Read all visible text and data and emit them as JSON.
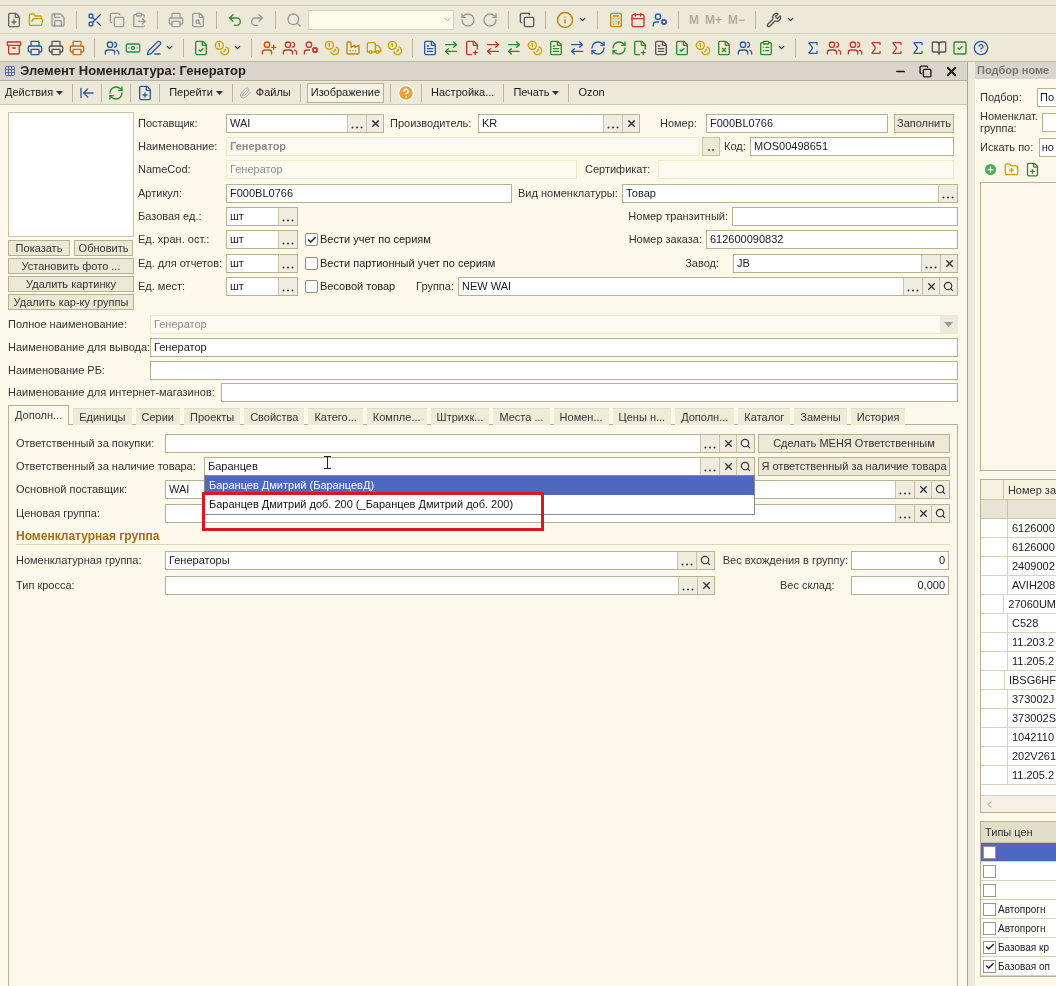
{
  "window": {
    "title": "Элемент Номенклатура: Генератор"
  },
  "toolbar": {
    "memory_buttons": [
      {
        "label": "M",
        "disabled": true
      },
      {
        "label": "M+",
        "disabled": true
      },
      {
        "label": "M−",
        "disabled": true
      }
    ]
  },
  "command_bar": [
    {
      "label": "Действия",
      "dropdown": true
    },
    {
      "label": "Перейти",
      "dropdown": true
    },
    {
      "label": "Файлы"
    },
    {
      "label": "Изображение",
      "pressed": true
    },
    {
      "label": "Настройка..."
    },
    {
      "label": "Печать",
      "dropdown": true
    },
    {
      "label": "Ozon"
    }
  ],
  "picture_buttons": [
    "Показать",
    "Обновить",
    "Установить фото ...",
    "Удалить картинку",
    "Удалить кар-ку группы"
  ],
  "fields": {
    "supplier": {
      "label": "Поставщик:",
      "value": "WAI"
    },
    "manufacturer": {
      "label": "Производитель:",
      "value": "KR"
    },
    "number": {
      "label": "Номер:",
      "value": "F000BL0766"
    },
    "name": {
      "label": "Наименование:",
      "value": "Генератор",
      "disabled": true
    },
    "code": {
      "label": "Код:",
      "value": "MOS00498651"
    },
    "name_cod": {
      "label": "NameCod:",
      "value": "Генератор",
      "disabled": true
    },
    "certificate": {
      "label": "Сертификат:",
      "disabled": true
    },
    "article": {
      "label": "Артикул:",
      "value": "F000BL0766"
    },
    "item_type": {
      "label": "Вид номенклатуры:",
      "value": "Товар"
    },
    "base_unit": {
      "label": "Базовая ед.:",
      "value": "шт"
    },
    "transit_number": {
      "label": "Номер транзитный:"
    },
    "storage_unit": {
      "label": "Ед. хран. ост.:",
      "value": "шт"
    },
    "order_number": {
      "label": "Номер заказа:",
      "value": "612600090832"
    },
    "report_unit": {
      "label": "Ед. для отчетов:",
      "value": "шт"
    },
    "plant": {
      "label": "Завод:",
      "value": "JB"
    },
    "place_unit": {
      "label": "Ед. мест:",
      "value": "шт"
    },
    "group": {
      "label": "Группа:",
      "value": "NEW WAI"
    },
    "full_name": {
      "label": "Полное наименование:",
      "value": "Генератор",
      "disabled": true
    },
    "output_name": {
      "label": "Наименование для вывода:",
      "value": "Генератор"
    },
    "rb_name": {
      "label": "Наименование РБ:"
    },
    "shop_name": {
      "label": "Наименование для интернет-магазинов:"
    }
  },
  "fill_button": "Заполнить",
  "checkboxes": [
    {
      "label": "Вести учет по сериям",
      "checked": true
    },
    {
      "label": "Вести партионный учет по сериям",
      "checked": false
    },
    {
      "label": "Весовой товар",
      "checked": false
    }
  ],
  "tabs": [
    {
      "label": "Дополн...",
      "selected": true
    },
    {
      "label": "Единицы",
      "selected": false
    },
    {
      "label": "Серии",
      "selected": false
    },
    {
      "label": "Проекты",
      "selected": false
    },
    {
      "label": "Свойства",
      "selected": false
    },
    {
      "label": "Катего...",
      "selected": false
    },
    {
      "label": "Компле...",
      "selected": false
    },
    {
      "label": "Штрихк...",
      "selected": false
    },
    {
      "label": "Места ...",
      "selected": false
    },
    {
      "label": "Номен...",
      "selected": false
    },
    {
      "label": "Цены н...",
      "selected": false
    },
    {
      "label": "Дополн...",
      "selected": false
    },
    {
      "label": "Каталог",
      "selected": false
    },
    {
      "label": "Замены",
      "selected": false
    },
    {
      "label": "История",
      "selected": false
    }
  ],
  "tab_content": {
    "fields": {
      "purchase_owner": {
        "label": "Ответственный за покупки:"
      },
      "stock_owner": {
        "label": "Ответственный за наличие товара:",
        "value": "Баранцев"
      },
      "main_supplier": {
        "label": "Основной поставщик:",
        "value": "WAI"
      },
      "price_group": {
        "label": "Ценовая группа:"
      },
      "item_group": {
        "label": "Номенклатурная группа:",
        "value": "Генераторы"
      },
      "group_weight": {
        "label": "Вес вхождения в группу:",
        "value": "0"
      },
      "cross_type": {
        "label": "Тип кросса:"
      },
      "stock_weight": {
        "label": "Вес склад:",
        "value": "0,000"
      }
    },
    "buttons": [
      "Сделать МЕНЯ Ответственным",
      "Я ответственный за наличие товара"
    ],
    "section_title": "Номенклатурная группа"
  },
  "dropdown": {
    "items": [
      {
        "label": "Баранцев Дмитрий (БаранцевД)",
        "selected": true
      },
      {
        "label": "Баранцев Дмитрий доб. 200 (_Баранцев Дмитрий доб. 200)",
        "selected": false
      }
    ]
  },
  "selection_panel": {
    "title": "Подбор номе",
    "fields": [
      {
        "label": "Подбор:",
        "value": "По"
      },
      {
        "label": "Номенклат. группа:"
      },
      {
        "label": "Искать по:",
        "value": "но"
      }
    ],
    "table": {
      "columns": [
        "Номер за"
      ],
      "rows": [
        "6126000",
        "6126000",
        "2409002",
        "AVIH208",
        "27060UM",
        "C528",
        "11.203.2",
        "11.205.2",
        "IBSG6HF",
        "373002J",
        "373002S",
        "1042110",
        "202V261",
        "11.205.2"
      ]
    },
    "price_types": {
      "title": "Типы цен",
      "rows": [
        {
          "checked": false,
          "selected": true
        },
        {
          "checked": false,
          "selected": false
        },
        {
          "checked": false,
          "selected": false
        },
        {
          "label": "Автопрогн",
          "checked": false,
          "selected": false
        },
        {
          "label": "Автопрогн",
          "checked": false,
          "selected": false
        },
        {
          "label": "Базовая кр",
          "checked": true,
          "selected": false
        },
        {
          "label": "Базовая оп",
          "checked": true,
          "selected": false
        }
      ]
    }
  }
}
